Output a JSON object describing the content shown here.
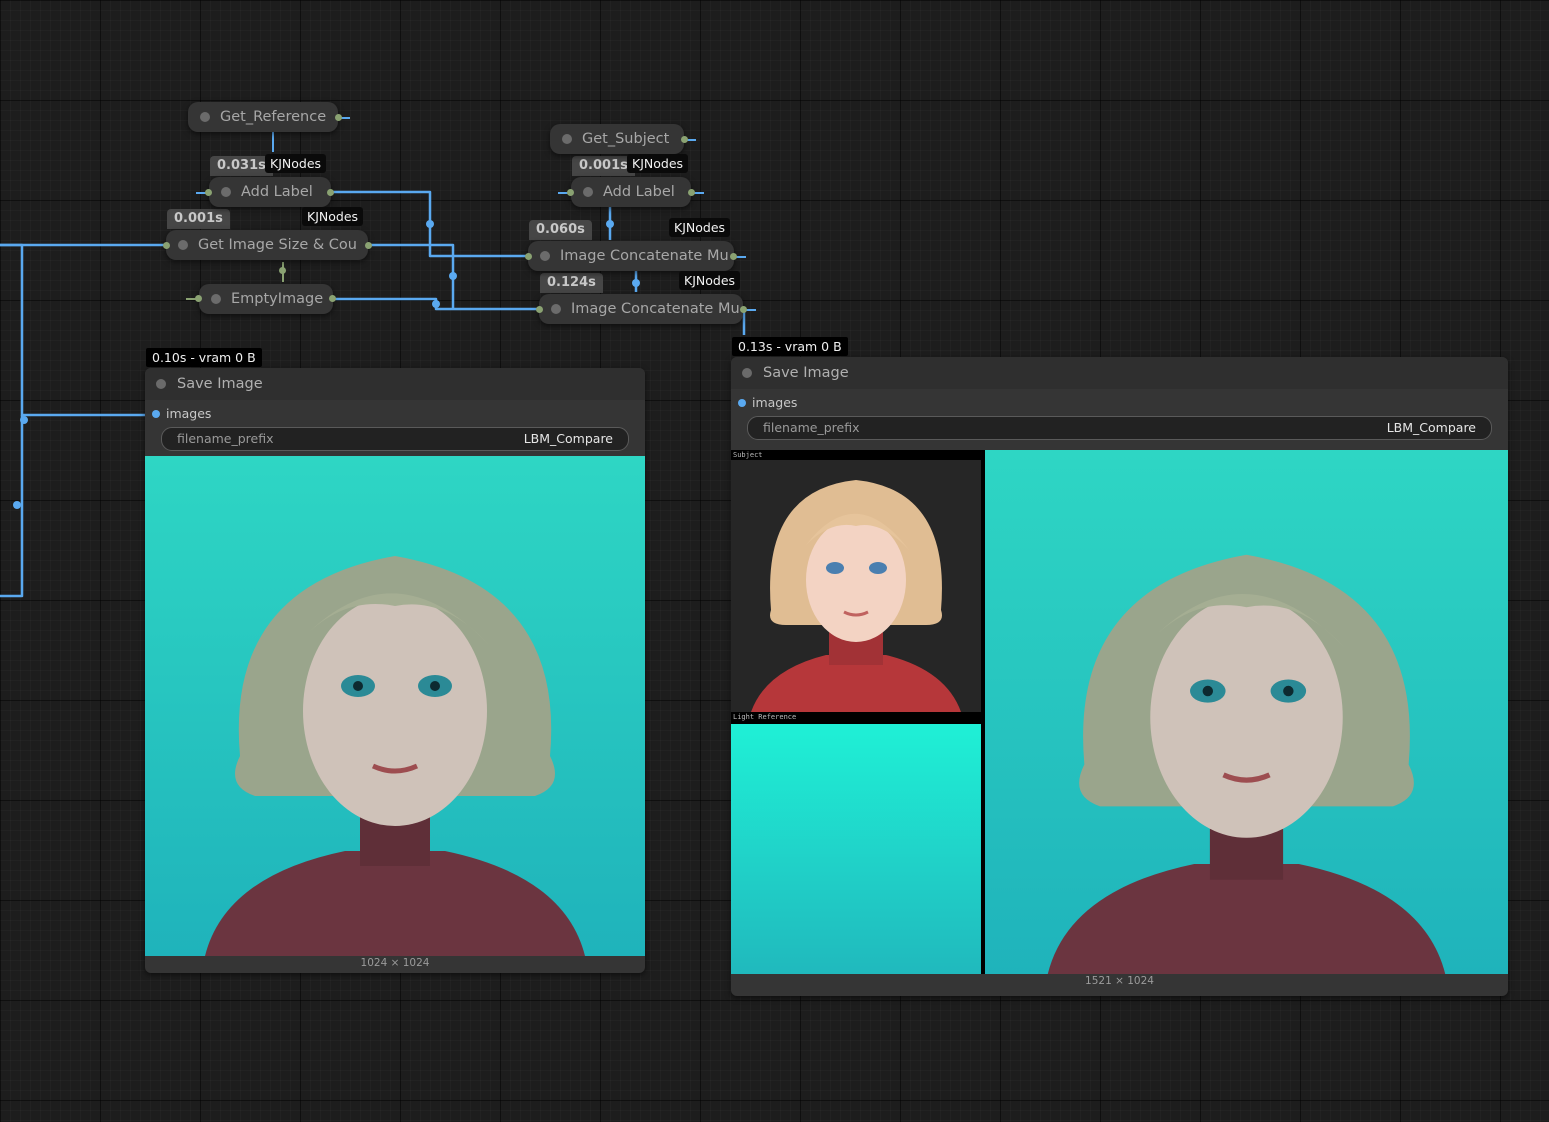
{
  "nodes": {
    "get_reference": {
      "title": "Get_Reference"
    },
    "add_label_1": {
      "title": "Add Label",
      "time": "0.031s",
      "tag": "KJNodes"
    },
    "get_image_size": {
      "title": "Get Image Size & Cou",
      "time": "0.001s",
      "tag": "KJNodes"
    },
    "empty_image": {
      "title": "EmptyImage"
    },
    "get_subject": {
      "title": "Get_Subject"
    },
    "add_label_2": {
      "title": "Add Label",
      "time": "0.001s",
      "tag": "KJNodes"
    },
    "concat_1": {
      "title": "Image Concatenate Mu",
      "time": "0.060s",
      "tag": "KJNodes"
    },
    "concat_2": {
      "title": "Image Concatenate Mu",
      "time": "0.124s",
      "tag": "KJNodes"
    }
  },
  "save_left": {
    "status": "0.10s - vram 0 B",
    "title": "Save Image",
    "input_label": "images",
    "widget_name": "filename_prefix",
    "widget_value": "LBM_Compare",
    "dims": "1024 × 1024"
  },
  "save_right": {
    "status": "0.13s - vram 0 B",
    "title": "Save Image",
    "input_label": "images",
    "widget_name": "filename_prefix",
    "widget_value": "LBM_Compare",
    "label_subject": "Subject",
    "label_light": "Light Reference",
    "dims": "1521 × 1024"
  },
  "colors": {
    "canvas": "#1d1d1d",
    "node": "#353535",
    "link_image": "#5aa9f0",
    "slot_int": "#8aa272",
    "teal": "#1fe0c8"
  }
}
